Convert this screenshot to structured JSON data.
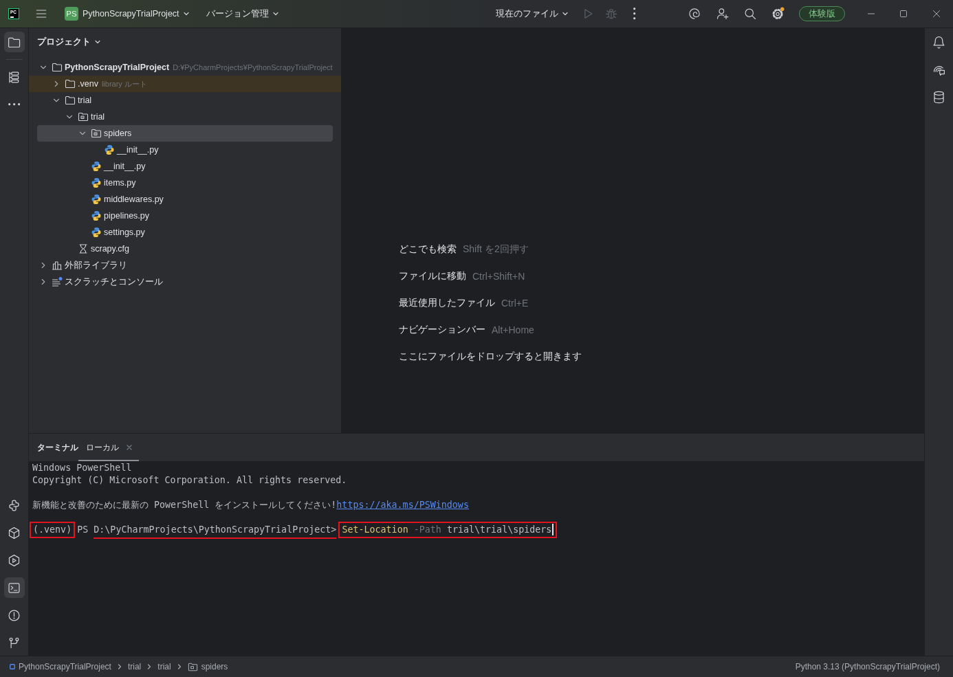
{
  "title_bar": {
    "app_logo": "PC",
    "project": {
      "badge": "PS",
      "name": "PythonScrapyTrialProject"
    },
    "vcs": "バージョン管理",
    "run_config": "現在のファイル",
    "run_disabled": true,
    "debug_disabled": true,
    "settings_badge": true,
    "trial": "体験版"
  },
  "left_toolbar": {
    "top": [
      {
        "kind": "project",
        "selected": true
      },
      {
        "kind": "structure",
        "selected": false
      },
      {
        "kind": "more",
        "selected": false
      }
    ],
    "bottom": [
      {
        "kind": "python_console",
        "selected": false
      },
      {
        "kind": "python_packages",
        "selected": false
      },
      {
        "kind": "services",
        "selected": false
      },
      {
        "kind": "terminal",
        "selected": true
      },
      {
        "kind": "problems",
        "selected": false
      },
      {
        "kind": "git",
        "selected": false
      }
    ]
  },
  "project_panel": {
    "title": "プロジェクト",
    "tree": [
      {
        "name": "PythonScrapyTrialProject",
        "kind": "project",
        "hint": "D:¥PyCharmProjects¥PythonScrapyTrialProject",
        "expanded": true,
        "selected": false,
        "tinted": false,
        "children": [
          {
            "name": ".venv",
            "kind": "folder",
            "hint": "library ルート",
            "expanded": false,
            "selected": false,
            "tinted": true
          },
          {
            "name": "trial",
            "kind": "folder",
            "expanded": true,
            "selected": false,
            "tinted": false,
            "children": [
              {
                "name": "trial",
                "kind": "package",
                "expanded": true,
                "selected": false,
                "tinted": false,
                "children": [
                  {
                    "name": "spiders",
                    "kind": "package",
                    "expanded": true,
                    "selected": true,
                    "tinted": false,
                    "children": [
                      {
                        "name": "__init__.py",
                        "kind": "python",
                        "selected": false,
                        "tinted": false
                      }
                    ]
                  },
                  {
                    "name": "__init__.py",
                    "kind": "python",
                    "selected": false,
                    "tinted": false
                  },
                  {
                    "name": "items.py",
                    "kind": "python",
                    "selected": false,
                    "tinted": false
                  },
                  {
                    "name": "middlewares.py",
                    "kind": "python",
                    "selected": false,
                    "tinted": false
                  },
                  {
                    "name": "pipelines.py",
                    "kind": "python",
                    "selected": false,
                    "tinted": false
                  },
                  {
                    "name": "settings.py",
                    "kind": "python",
                    "selected": false,
                    "tinted": false
                  }
                ]
              },
              {
                "name": "scrapy.cfg",
                "kind": "config",
                "selected": false,
                "tinted": false
              }
            ]
          }
        ]
      },
      {
        "name": "外部ライブラリ",
        "kind": "library",
        "expanded": false,
        "selected": false,
        "tinted": false
      },
      {
        "name": "スクラッチとコンソール",
        "kind": "scratch",
        "expanded": false,
        "selected": false,
        "tinted": false
      }
    ]
  },
  "editor_hints": [
    {
      "action": "どこでも検索",
      "shortcut": "Shift を2回押す"
    },
    {
      "action": "ファイルに移動",
      "shortcut": "Ctrl+Shift+N"
    },
    {
      "action": "最近使用したファイル",
      "shortcut": "Ctrl+E"
    },
    {
      "action": "ナビゲーションバー",
      "shortcut": "Alt+Home"
    },
    {
      "action": "ここにファイルをドロップすると開きます"
    }
  ],
  "right_toolbar": [
    {
      "kind": "notifications"
    },
    {
      "kind": "ai_chat"
    },
    {
      "kind": "database"
    }
  ],
  "terminal": {
    "title": "ターミナル",
    "tabs": [
      {
        "label": "ローカル",
        "selected": true,
        "closable": true
      }
    ],
    "output": [
      {
        "lines": [
          {
            "text": "Windows PowerShell"
          },
          {
            "text": "Copyright (C) Microsoft Corporation. All rights reserved."
          }
        ]
      },
      {
        "lines": [
          {
            "text": "新機能と改善のために最新の PowerShell をインストールしてください!",
            "link": "https://aka.ms/PSWindows"
          }
        ]
      }
    ],
    "prompt": {
      "cursor": true,
      "groups": [
        {
          "boxed": true,
          "underlined": false,
          "tokens": [
            {
              "text": "(.venv)",
              "kind": "plain"
            }
          ]
        },
        {
          "boxed": false,
          "underlined": false,
          "tokens": [
            {
              "text": "PS",
              "kind": "plain"
            }
          ]
        },
        {
          "boxed": false,
          "underlined": true,
          "tokens": [
            {
              "text": "D:\\PyCharmProjects\\PythonScrapyTrialProject>",
              "kind": "plain"
            }
          ]
        },
        {
          "boxed": true,
          "underlined": false,
          "tokens": [
            {
              "text": "Set-Location",
              "kind": "command"
            },
            {
              "text": "-Path",
              "kind": "parameter"
            },
            {
              "text": "trial\\trial\\spiders",
              "kind": "plain"
            }
          ]
        }
      ]
    }
  },
  "status_bar": {
    "breadcrumbs": [
      {
        "label": "PythonScrapyTrialProject",
        "kind": "module"
      },
      {
        "label": "trial",
        "kind": "directory"
      },
      {
        "label": "trial",
        "kind": "directory"
      },
      {
        "label": "spiders",
        "kind": "package"
      }
    ],
    "interpreter": "Python 3.13 (PythonScrapyTrialProject)"
  }
}
